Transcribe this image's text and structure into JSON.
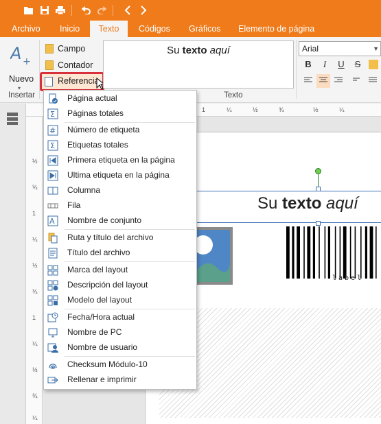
{
  "tabs": [
    "Archivo",
    "Inicio",
    "Texto",
    "Códigos",
    "Gráficos",
    "Elemento de página"
  ],
  "active_tab": "Texto",
  "ribbon": {
    "nuevo_label": "Nuevo",
    "insertar_label": "Insertar",
    "campo_label": "Campo",
    "contador_label": "Contador",
    "referencia_label": "Referencia",
    "texto_group_label": "Texto",
    "preview_prefix": "Su",
    "preview_bold": "texto",
    "preview_italic": "aquí",
    "font_name": "Arial"
  },
  "menu": {
    "items": [
      {
        "label": "Página actual",
        "icon": "page-check-icon"
      },
      {
        "label": "Páginas totales",
        "icon": "sigma-icon"
      },
      {
        "label": "Número de etiqueta",
        "icon": "hash-icon"
      },
      {
        "label": "Etiquetas totales",
        "icon": "sigma-icon"
      },
      {
        "label": "Primera etiqueta en la página",
        "icon": "first-icon"
      },
      {
        "label": "Ultima etiqueta en la página",
        "icon": "last-icon"
      },
      {
        "label": "Columna",
        "icon": "column-icon"
      },
      {
        "label": "Fila",
        "icon": "row-icon"
      },
      {
        "label": "Nombre de conjunto",
        "icon": "set-icon"
      },
      {
        "label": "Ruta y título del archivo",
        "icon": "file-path-icon"
      },
      {
        "label": "Título del archivo",
        "icon": "file-title-icon"
      },
      {
        "label": "Marca del layout",
        "icon": "layout-mark-icon"
      },
      {
        "label": "Descripción del layout",
        "icon": "layout-description-icon"
      },
      {
        "label": "Modelo del layout",
        "icon": "layout-model-icon"
      },
      {
        "label": "Fecha/Hora actual",
        "icon": "calendar-clock-icon"
      },
      {
        "label": "Nombre de PC",
        "icon": "monitor-icon"
      },
      {
        "label": "Nombre de usuario",
        "icon": "user-icon"
      },
      {
        "label": "Checksum Módulo-10",
        "icon": "fingerprint-icon"
      },
      {
        "label": "Rellenar e imprimir",
        "icon": "fill-print-icon"
      }
    ]
  },
  "canvas": {
    "text_prefix": "Su",
    "text_bold": "texto",
    "text_italic": "aquí",
    "barcode_caption": "label"
  },
  "ruler": {
    "h_marks": [
      "1",
      "¼",
      "½",
      "¾",
      "½",
      "¼"
    ],
    "v_marks": [
      "½",
      "¾",
      "1",
      "¼",
      "½",
      "¾",
      "1",
      "¼",
      "½",
      "¾",
      "¼"
    ]
  },
  "colors": {
    "accent": "#ef7b1b",
    "highlight": "#d9313b"
  }
}
